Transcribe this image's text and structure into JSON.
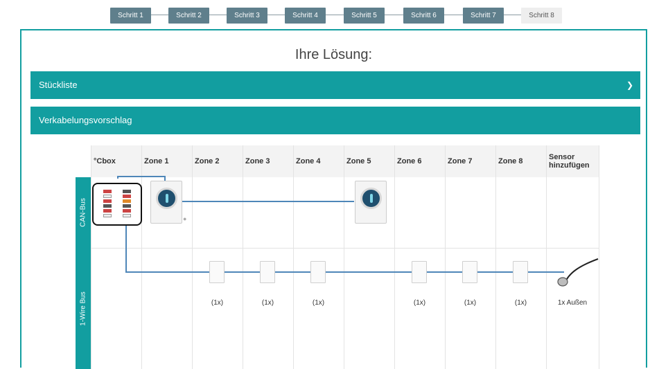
{
  "steps": [
    "Schritt 1",
    "Schritt 2",
    "Schritt 3",
    "Schritt 4",
    "Schritt 5",
    "Schritt 6",
    "Schritt 7",
    "Schritt 8"
  ],
  "active_step": "Schritt 8",
  "title": "Ihre Lösung:",
  "sections": {
    "parts_list": "Stückliste",
    "wiring": "Verkabelungsvorschlag"
  },
  "table": {
    "columns": [
      "°Cbox",
      "Zone 1",
      "Zone 2",
      "Zone 3",
      "Zone 4",
      "Zone 5",
      "Zone 6",
      "Zone 7",
      "Zone 8",
      "Sensor hinzufügen"
    ],
    "rows": [
      "CAN-Bus",
      "1-Wire Bus"
    ],
    "counts": [
      "(1x)",
      "(1x)",
      "(1x)",
      "(1x)",
      "(1x)",
      "(1x)"
    ],
    "outdoor": "1x Außen"
  },
  "colors": {
    "teal": "#129ea0",
    "step": "#5f7f8c",
    "wire": "#4e86b8"
  }
}
